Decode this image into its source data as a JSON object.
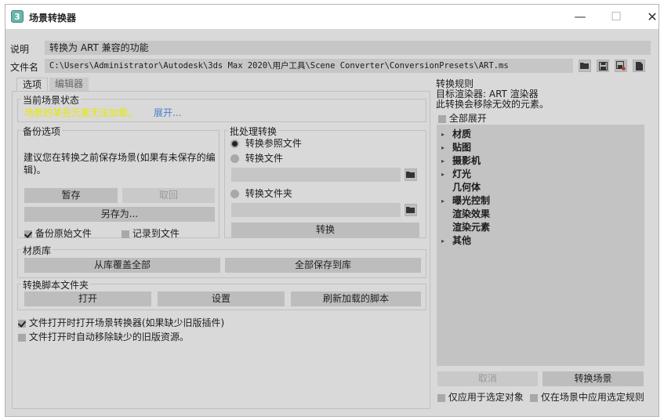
{
  "window": {
    "title": "场景转换器",
    "app_icon_glyph": "3"
  },
  "controls": {
    "minimize": "—",
    "maximize": "☐",
    "close": "✕"
  },
  "description": {
    "label": "说明",
    "value": "转换为 ART 兼容的功能"
  },
  "filename": {
    "label": "文件名",
    "value": "C:\\Users\\Administrator\\Autodesk\\3ds Max 2020\\用户工具\\Scene Converter\\ConversionPresets\\ART.ms"
  },
  "file_toolbar": [
    "folder-open-icon",
    "save-icon",
    "save-as-icon",
    "new-file-icon"
  ],
  "tabs": [
    {
      "label": "选项",
      "active": true
    },
    {
      "label": "编辑器",
      "active": false
    }
  ],
  "scene_state": {
    "title": "当前场景状态",
    "warning": "场景的某些元素无法加载。",
    "warning_color": "#e8e800",
    "expand_link": "展开..."
  },
  "backup": {
    "title": "备份选项",
    "message": "建议您在转换之前保存场景(如果有未保存的编辑)。",
    "hold_button": "暂存",
    "fetch_button": "取回",
    "save_as_button": "另存为...",
    "backup_original": {
      "label": "备份原始文件",
      "checked": true
    },
    "log_to_file": {
      "label": "记录到文件",
      "checked": false
    }
  },
  "batch": {
    "title": "批处理转换",
    "options": [
      {
        "label": "转换参照文件",
        "selected": true
      },
      {
        "label": "转换文件",
        "selected": false
      },
      {
        "label": "转换文件夹",
        "selected": false
      }
    ],
    "file_path": "",
    "folder_path": "",
    "convert_button": "转换"
  },
  "material_lib": {
    "title": "材质库",
    "overwrite_button": "从库覆盖全部",
    "save_all_button": "全部保存到库"
  },
  "script_files": {
    "title": "转换脚本文件夹",
    "open_button": "打开",
    "setup_button": "设置",
    "reload_button": "刷新加载的脚本"
  },
  "global_options": [
    {
      "label": "文件打开时打开场景转换器(如果缺少旧版插件)",
      "checked": true
    },
    {
      "label": "文件打开时自动移除缺少的旧版资源。",
      "checked": false
    }
  ],
  "rules": {
    "title": "转换规则",
    "target_line": "目标渲染器: ART 渲染器",
    "remove_line": "此转换会移除无效的元素。",
    "expand_all": {
      "label": "全部展开",
      "checked": false
    },
    "items": [
      {
        "label": "材质",
        "expandable": true
      },
      {
        "label": "贴图",
        "expandable": true
      },
      {
        "label": "摄影机",
        "expandable": true
      },
      {
        "label": "灯光",
        "expandable": true
      },
      {
        "label": "几何体",
        "expandable": false
      },
      {
        "label": "曝光控制",
        "expandable": true
      },
      {
        "label": "渲染效果",
        "expandable": false
      },
      {
        "label": "渲染元素",
        "expandable": false
      },
      {
        "label": "其他",
        "expandable": true
      }
    ],
    "cancel_button": "取消",
    "convert_scene_button": "转换场景",
    "apply_selected": {
      "label": "仅应用于选定对象",
      "checked": false
    },
    "apply_selected_rules": {
      "label": "仅在场景中应用选定规则",
      "checked": false
    }
  }
}
